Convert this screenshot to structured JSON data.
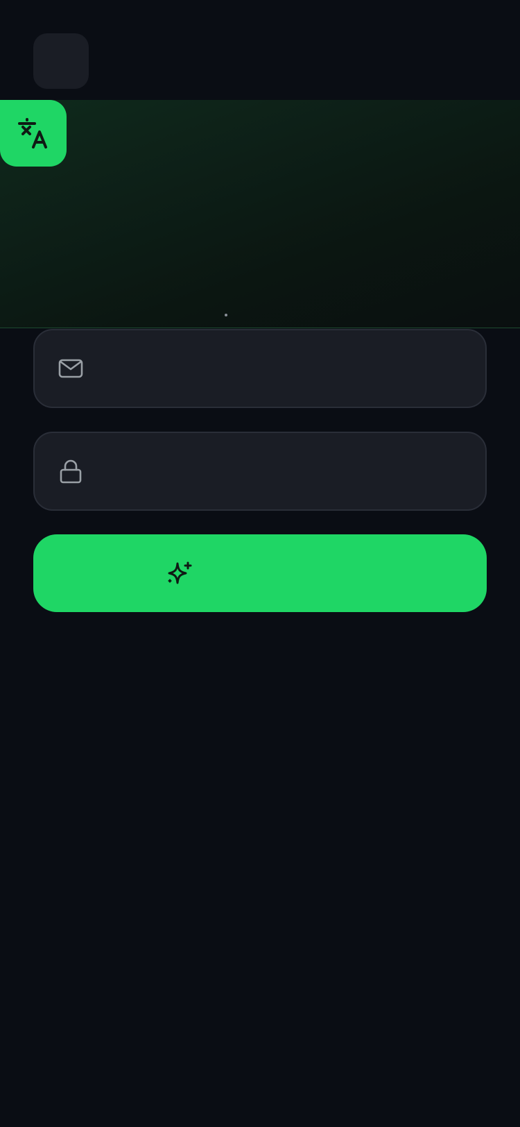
{
  "header": {
    "logo_placeholder": ""
  },
  "language_button": {
    "icon": "translate-icon",
    "label": ""
  },
  "carousel": {
    "indicator_count": 1
  },
  "form": {
    "email": {
      "icon": "mail-icon",
      "value": "",
      "placeholder": ""
    },
    "password": {
      "icon": "lock-icon",
      "value": "",
      "placeholder": ""
    },
    "submit": {
      "icon": "sparkles-icon",
      "label": ""
    }
  },
  "colors": {
    "background": "#0a0d14",
    "accent": "#1fd665",
    "field_bg": "#1a1d25",
    "field_border": "#2a2e38",
    "icon_muted": "#9aa0a6"
  }
}
